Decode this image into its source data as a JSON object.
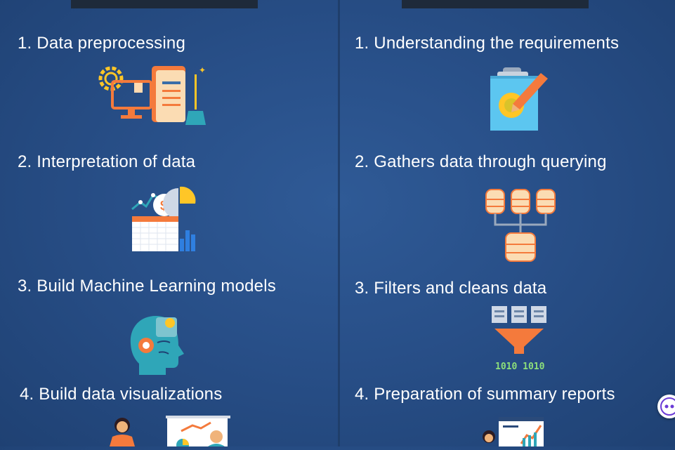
{
  "left_column": {
    "items": [
      {
        "label": "1.   Data preprocessing",
        "icon": "data-preprocessing-icon"
      },
      {
        "label": "2.  Interpretation of data",
        "icon": "data-interpretation-icon"
      },
      {
        "label": "3. Build Machine Learning models",
        "icon": "machine-learning-head-icon"
      },
      {
        "label": "4. Build data visualizations",
        "icon": "presentation-icon"
      }
    ]
  },
  "right_column": {
    "items": [
      {
        "label": "1. Understanding the requirements",
        "icon": "clipboard-pencil-icon"
      },
      {
        "label": "2. Gathers data through querying",
        "icon": "database-query-icon"
      },
      {
        "label": "3. Filters and cleans data",
        "icon": "filter-funnel-icon"
      },
      {
        "label": "4. Preparation of summary reports",
        "icon": "report-chart-icon"
      }
    ]
  },
  "binary_text": "1010 1010",
  "colors": {
    "background": "#2b5490",
    "accent_orange": "#f47a3c",
    "accent_yellow": "#ffc627",
    "accent_teal": "#2fa6b8",
    "db_cream": "#fbdcb3"
  }
}
